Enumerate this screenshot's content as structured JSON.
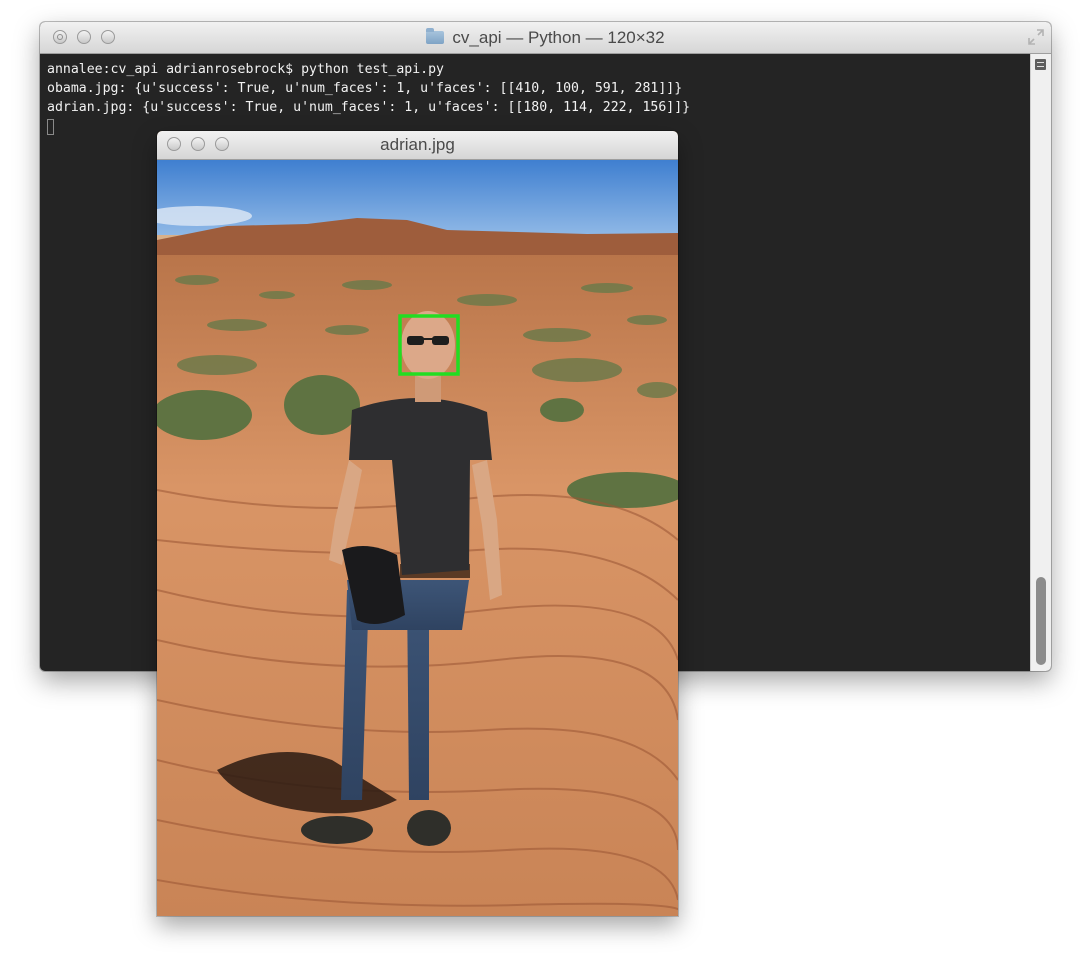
{
  "terminal": {
    "title": "cv_api — Python — 120×32",
    "title_icon": "folder-icon",
    "lines": [
      "annalee:cv_api adrianrosebrock$ python test_api.py",
      "obama.jpg: {u'success': True, u'num_faces': 1, u'faces': [[410, 100, 591, 281]]}",
      "adrian.jpg: {u'success': True, u'num_faces': 1, u'faces': [[180, 114, 222, 156]]}"
    ],
    "background_color": "#242424",
    "text_color": "#f2f2f2"
  },
  "image_window": {
    "title": "adrian.jpg",
    "photo_description_icon": "photo-image",
    "face_box_color": "#22dd22"
  }
}
